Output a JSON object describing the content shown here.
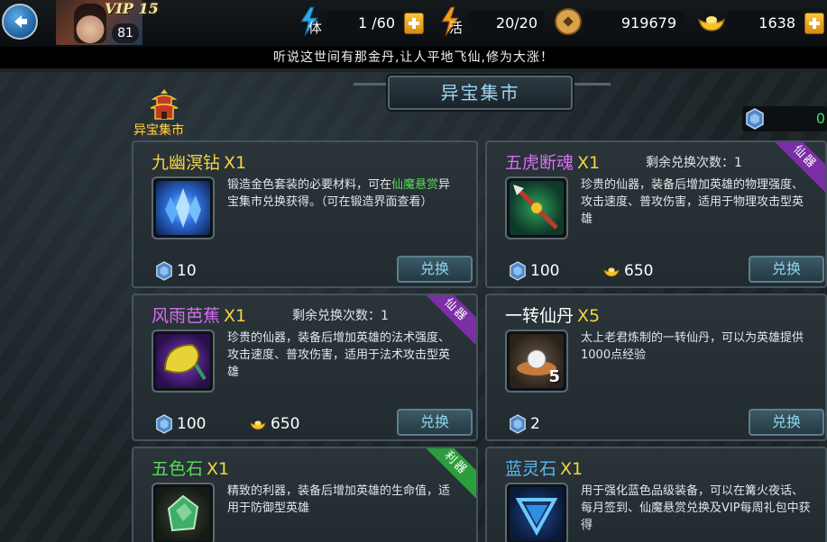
{
  "header": {
    "vip": "VIP 15",
    "level": "81",
    "stamina": {
      "label": "体",
      "value": "1 /60"
    },
    "activity": {
      "label": "活",
      "value": "20/20"
    },
    "coins": "919679",
    "gold": "1638"
  },
  "ticker": "听说这世间有那金丹,让人平地飞仙,修为大涨！",
  "shop": {
    "title": "异宝集市",
    "badge_label": "异宝集市",
    "balance": "0",
    "exchange_label": "兑换",
    "items": [
      {
        "name": "九幽溟钻",
        "qty": "X1",
        "name_color": "#f3d543",
        "desc_pre": "锻造金色套装的必要材料，可在",
        "desc_hl": "仙魔悬赏",
        "desc_post": "异宝集市兑换获得。（可在锻造界面查看）",
        "price_crystal": "10"
      },
      {
        "name": "五虎断魂",
        "qty": "X1",
        "name_color": "#d86ff0",
        "remain": "剩余兑换次数：1",
        "ribbon": "仙器",
        "desc": "珍贵的仙器，装备后增加英雄的物理强度、攻击速度、普攻伤害，适用于物理攻击型英雄",
        "price_crystal": "100",
        "price_gold": "650"
      },
      {
        "name": "风雨芭蕉",
        "qty": "X1",
        "name_color": "#d86ff0",
        "remain": "剩余兑换次数：1",
        "ribbon": "仙器",
        "desc": "珍贵的仙器，装备后增加英雄的法术强度、攻击速度、普攻伤害，适用于法术攻击型英雄",
        "price_crystal": "100",
        "price_gold": "650"
      },
      {
        "name": "一转仙丹",
        "qty": "X5",
        "name_color": "#ffffff",
        "desc": "太上老君炼制的一转仙丹，可以为英雄提供1000点经验",
        "item_count": "5",
        "price_crystal": "2"
      },
      {
        "name": "五色石",
        "qty": "X1",
        "name_color": "#5bdc58",
        "ribbon": "利器",
        "desc": "精致的利器，装备后增加英雄的生命值，适用于防御型英雄"
      },
      {
        "name": "蓝灵石",
        "qty": "X1",
        "name_color": "#5ab7f0",
        "desc": "用于强化蓝色品级装备，可以在篝火夜话、每月签到、仙魔悬赏兑换及VIP每周礼包中获得"
      }
    ]
  }
}
